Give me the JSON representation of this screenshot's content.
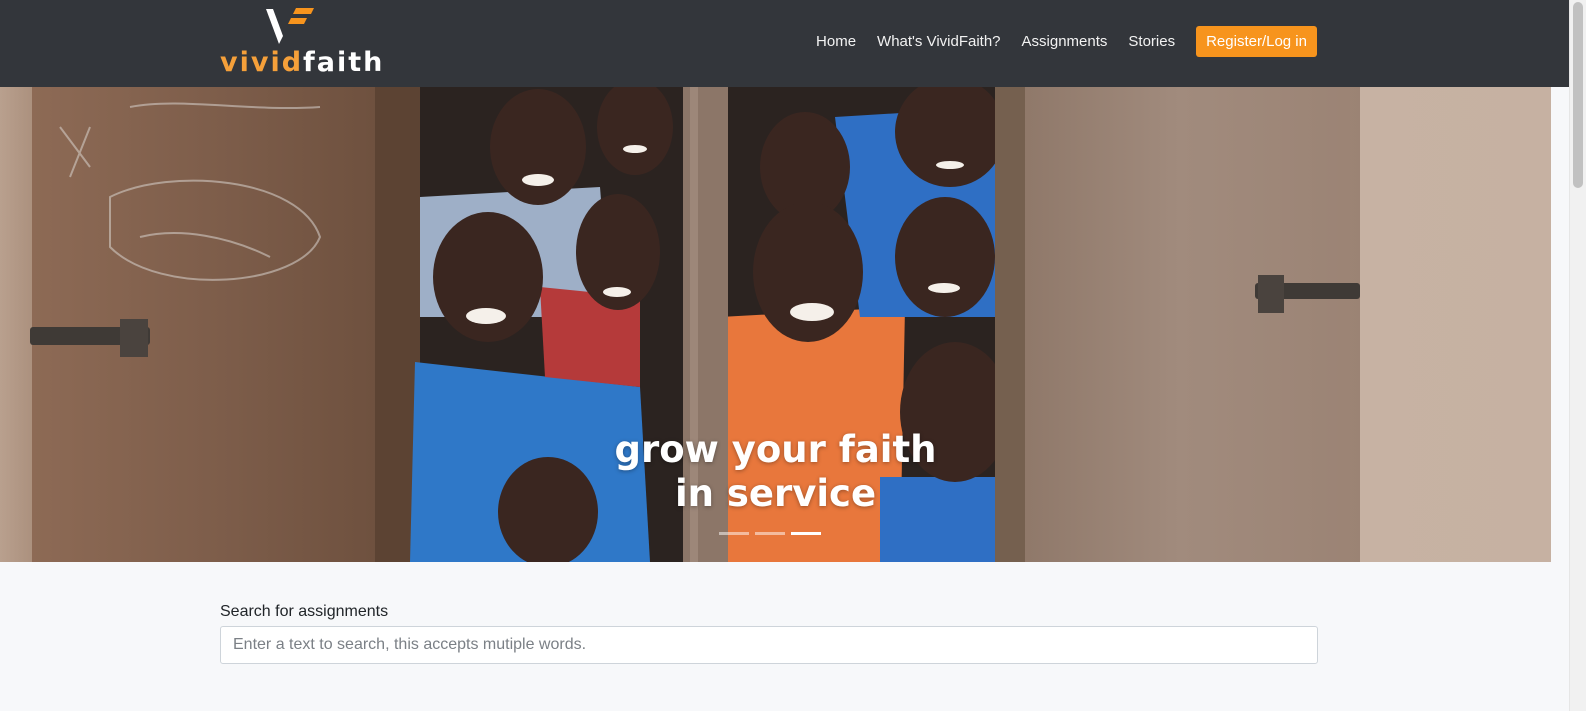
{
  "brand": {
    "name_part1": "vivid",
    "name_part2": "faith",
    "accent_color": "#f7941d",
    "navbar_color": "#33363b"
  },
  "nav": {
    "items": [
      {
        "label": "Home"
      },
      {
        "label": "What's VividFaith?"
      },
      {
        "label": "Assignments"
      },
      {
        "label": "Stories"
      }
    ],
    "register_login_label": "Register/Log in"
  },
  "hero": {
    "caption_line1": "grow your faith",
    "caption_line2": "in service",
    "slide_count": 3,
    "active_slide": 3
  },
  "search": {
    "label": "Search for assignments",
    "placeholder": "Enter a text to search, this accepts mutiple words.",
    "value": ""
  }
}
